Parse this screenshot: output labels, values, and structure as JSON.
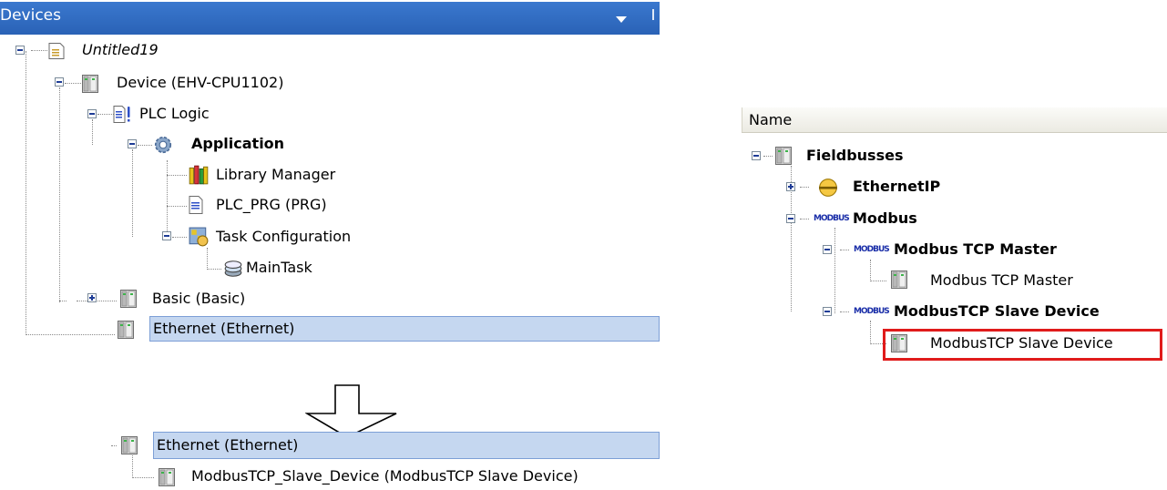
{
  "devices_pane": {
    "title": "Devices",
    "tree": {
      "project": "Untitled19",
      "device": "Device (EHV-CPU1102)",
      "plc_logic": "PLC Logic",
      "application": "Application",
      "library_manager": "Library Manager",
      "plc_prg": "PLC_PRG (PRG)",
      "task_configuration": "Task Configuration",
      "main_task": "MainTask",
      "basic": "Basic (Basic)",
      "ethernet": "Ethernet (Ethernet)"
    }
  },
  "result_tree": {
    "ethernet": "Ethernet (Ethernet)",
    "slave_device": "ModbusTCP_Slave_Device (ModbusTCP Slave Device)"
  },
  "device_catalog": {
    "column_header": "Name",
    "items": {
      "fieldbusses": "Fieldbusses",
      "ethernetip": "EthernetIP",
      "modbus": "Modbus",
      "modbus_tcp_master_group": "Modbus TCP Master",
      "modbus_tcp_master_item": "Modbus TCP Master",
      "modbus_tcp_slave_group": "ModbusTCP Slave Device",
      "modbus_tcp_slave_item": "ModbusTCP Slave Device"
    },
    "modbus_logo_text": "MODBUS",
    "highlight_color": "#e01b1b"
  },
  "colors": {
    "pane_header": "#2a62b6",
    "selection": "#c5d7f0"
  }
}
